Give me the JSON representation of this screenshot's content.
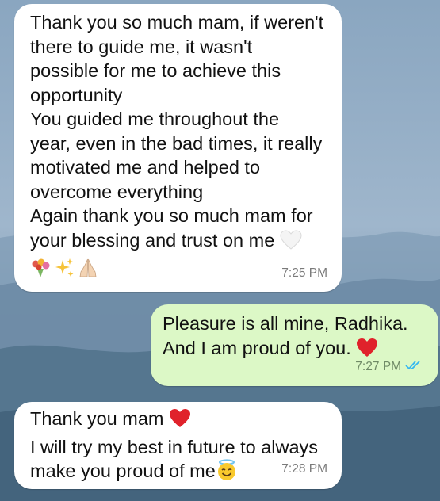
{
  "chat": {
    "messages": [
      {
        "direction": "incoming",
        "lines": [
          "Thank you so much mam, if weren't",
          "there to guide me, it wasn't",
          "possible for me to achieve this",
          "opportunity",
          "You guided me throughout the",
          "year, even in the bad times, it really",
          "motivated me and helped to",
          "overcome everything",
          "Again thank you so much mam for",
          "your blessing and trust on me"
        ],
        "trailing_emoji": "white-heart-icon",
        "emoji_row": [
          "bouquet-icon",
          "sparkles-icon",
          "folded-hands-icon"
        ],
        "time": "7:25 PM"
      },
      {
        "direction": "outgoing",
        "lines": [
          "Pleasure is all mine, Radhika.",
          "And I am proud of you."
        ],
        "trailing_emoji": "red-heart-icon",
        "time": "7:27 PM",
        "status": "read-double-check-icon"
      },
      {
        "direction": "incoming",
        "lines": [
          "Thank you mam",
          "I will try my best in future to always",
          "make you proud of me"
        ],
        "line_emojis": [
          "red-heart-icon",
          "",
          "smiling-face-with-halo-icon"
        ],
        "time": "7:28 PM"
      }
    ]
  },
  "colors": {
    "incoming_bubble": "#ffffff",
    "outgoing_bubble": "#dcf8c6",
    "read_receipt": "#34b7f1"
  }
}
